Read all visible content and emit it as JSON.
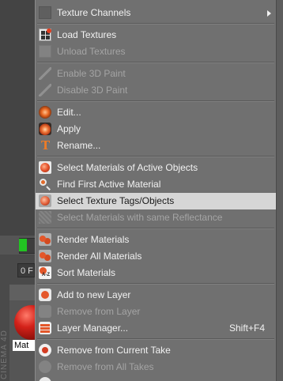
{
  "background": {
    "frame_field_text": "0 F",
    "material_name": "Mat",
    "brand_text": "CINEMA 4D"
  },
  "menu": {
    "items": [
      {
        "label": "Texture Channels",
        "icon": "texture-channels-icon",
        "enabled": true,
        "submenu": true
      },
      {
        "label": "Load Textures",
        "icon": "load-textures-icon",
        "enabled": true
      },
      {
        "label": "Unload Textures",
        "icon": "unload-textures-icon",
        "enabled": false
      },
      {
        "label": "Enable 3D Paint",
        "icon": "paint-brush-icon",
        "enabled": false
      },
      {
        "label": "Disable 3D Paint",
        "icon": "paint-brush-icon",
        "enabled": false
      },
      {
        "label": "Edit...",
        "icon": "material-edit-icon",
        "enabled": true
      },
      {
        "label": "Apply",
        "icon": "material-apply-icon",
        "enabled": true
      },
      {
        "label": "Rename...",
        "icon": "rename-t-icon",
        "enabled": true
      },
      {
        "label": "Select Materials of Active Objects",
        "icon": "select-materials-icon",
        "enabled": true
      },
      {
        "label": "Find First Active Material",
        "icon": "magnifier-icon",
        "enabled": true
      },
      {
        "label": "Select Texture Tags/Objects",
        "icon": "texture-tag-icon",
        "enabled": true,
        "highlighted": true
      },
      {
        "label": "Select Materials with same Reflectance",
        "icon": "reflectance-icon",
        "enabled": false
      },
      {
        "label": "Render Materials",
        "icon": "render-materials-icon",
        "enabled": true
      },
      {
        "label": "Render All Materials",
        "icon": "render-all-materials-icon",
        "enabled": true
      },
      {
        "label": "Sort Materials",
        "icon": "sort-az-icon",
        "enabled": true
      },
      {
        "label": "Add to new Layer",
        "icon": "add-layer-icon",
        "enabled": true
      },
      {
        "label": "Remove from Layer",
        "icon": "remove-layer-icon",
        "enabled": false
      },
      {
        "label": "Layer Manager...",
        "icon": "layer-manager-icon",
        "enabled": true,
        "shortcut": "Shift+F4"
      },
      {
        "label": "Remove from Current Take",
        "icon": "take-remove-icon",
        "enabled": true
      },
      {
        "label": "Remove from All Takes",
        "icon": "take-remove-all-icon",
        "enabled": false
      }
    ]
  },
  "colors": {
    "menu_bg": "#707070",
    "highlight_bg": "#d6d6d6",
    "text": "#f2f2f2",
    "text_disabled": "#a4a4a4",
    "accent_orange": "#e4572a"
  }
}
